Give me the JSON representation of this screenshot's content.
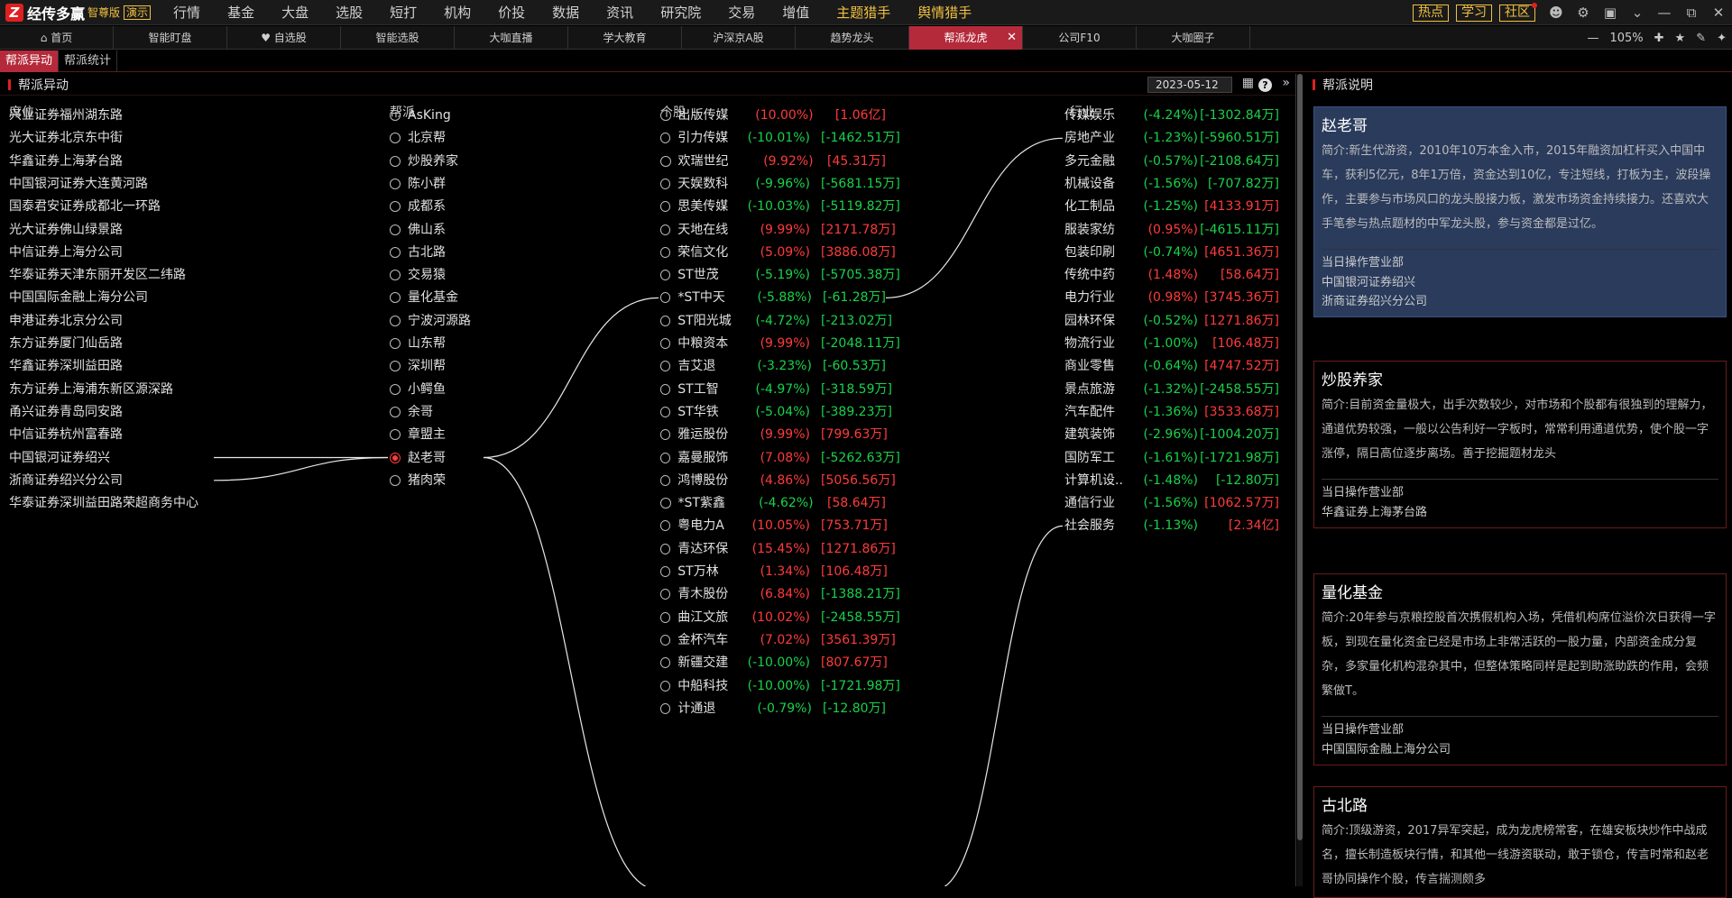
{
  "app": {
    "mark": "Z",
    "name": "经传多赢",
    "edition": "智尊版",
    "demo": "演示"
  },
  "menu": [
    {
      "label": "行情",
      "dot": true
    },
    {
      "label": "基金"
    },
    {
      "label": "大盘"
    },
    {
      "label": "选股"
    },
    {
      "label": "短打"
    },
    {
      "label": "机构"
    },
    {
      "label": "价投"
    },
    {
      "label": "数据"
    },
    {
      "label": "资讯"
    },
    {
      "label": "研究院"
    },
    {
      "label": "交易"
    },
    {
      "label": "增值",
      "dot": true
    },
    {
      "label": "主题猎手",
      "dot": true,
      "hl": true
    },
    {
      "label": "舆情猎手",
      "dot": true,
      "hl": true
    }
  ],
  "menu_right": {
    "pills": [
      {
        "label": "热点"
      },
      {
        "label": "学习"
      },
      {
        "label": "社区",
        "dot": true
      }
    ]
  },
  "tabs": [
    {
      "label": "首页",
      "icon": "home-icon"
    },
    {
      "label": "智能盯盘"
    },
    {
      "label": "自选股",
      "icon": "heart-icon"
    },
    {
      "label": "智能选股"
    },
    {
      "label": "大咖直播"
    },
    {
      "label": "学大教育"
    },
    {
      "label": "沪深京A股"
    },
    {
      "label": "趋势龙头"
    },
    {
      "label": "帮派龙虎",
      "active": true
    },
    {
      "label": "公司F10"
    },
    {
      "label": "大咖圈子"
    }
  ],
  "zoom": "105%",
  "subtabs": [
    {
      "label": "帮派异动",
      "active": true
    },
    {
      "label": "帮派统计"
    }
  ],
  "left_panel": {
    "title": "帮派异动",
    "date": "2023-05-12"
  },
  "columns": {
    "seat": "席位",
    "gang": "帮派",
    "stock": "个股",
    "industry": "行业"
  },
  "seats": [
    "兴业证券福州湖东路",
    "光大证券北京东中街",
    "华鑫证券上海茅台路",
    "中国银河证券大连黄河路",
    "国泰君安证券成都北一环路",
    "光大证券佛山绿景路",
    "中信证券上海分公司",
    "华泰证券天津东丽开发区二纬路",
    "中国国际金融上海分公司",
    "申港证券北京分公司",
    "东方证券厦门仙岳路",
    "华鑫证券深圳益田路",
    "东方证券上海浦东新区源深路",
    "甬兴证券青岛同安路",
    "中信证券杭州富春路",
    "中国银河证券绍兴",
    "浙商证券绍兴分公司",
    "华泰证券深圳益田路荣超商务中心"
  ],
  "gangs": [
    {
      "name": "AsKing"
    },
    {
      "name": "北京帮"
    },
    {
      "name": "炒股养家"
    },
    {
      "name": "陈小群"
    },
    {
      "name": "成都系"
    },
    {
      "name": "佛山系"
    },
    {
      "name": "古北路"
    },
    {
      "name": "交易猿"
    },
    {
      "name": "量化基金"
    },
    {
      "name": "宁波河源路"
    },
    {
      "name": "山东帮"
    },
    {
      "name": "深圳帮"
    },
    {
      "name": "小鳄鱼"
    },
    {
      "name": "余哥"
    },
    {
      "name": "章盟主"
    },
    {
      "name": "赵老哥",
      "selected": true
    },
    {
      "name": "猪肉荣"
    }
  ],
  "stocks": [
    {
      "name": "出版传媒",
      "pct": "(10.00%)",
      "amt": "[1.06亿]",
      "up": true,
      "amt_up": true
    },
    {
      "name": "引力传媒",
      "pct": "(-10.01%)",
      "amt": "[-1462.51万]",
      "up": false,
      "amt_up": false
    },
    {
      "name": "欢瑞世纪",
      "pct": "(9.92%)",
      "amt": "[45.31万]",
      "up": true,
      "amt_up": true
    },
    {
      "name": "天娱数科",
      "pct": "(-9.96%)",
      "amt": "[-5681.15万]",
      "up": false,
      "amt_up": false
    },
    {
      "name": "思美传媒",
      "pct": "(-10.03%)",
      "amt": "[-5119.82万]",
      "up": false,
      "amt_up": false
    },
    {
      "name": "天地在线",
      "pct": "(9.99%)",
      "amt": "[2171.78万]",
      "up": true,
      "amt_up": true
    },
    {
      "name": "荣信文化",
      "pct": "(5.09%)",
      "amt": "[3886.08万]",
      "up": true,
      "amt_up": true
    },
    {
      "name": "ST世茂",
      "pct": "(-5.19%)",
      "amt": "[-5705.38万]",
      "up": false,
      "amt_up": false
    },
    {
      "name": "*ST中天",
      "pct": "(-5.88%)",
      "amt": "[-61.28万]",
      "up": false,
      "amt_up": false
    },
    {
      "name": "ST阳光城",
      "pct": "(-4.72%)",
      "amt": "[-213.02万]",
      "up": false,
      "amt_up": false
    },
    {
      "name": "中粮资本",
      "pct": "(9.99%)",
      "amt": "[-2048.11万]",
      "up": true,
      "amt_up": false
    },
    {
      "name": "吉艾退",
      "pct": "(-3.23%)",
      "amt": "[-60.53万]",
      "up": false,
      "amt_up": false
    },
    {
      "name": "ST工智",
      "pct": "(-4.97%)",
      "amt": "[-318.59万]",
      "up": false,
      "amt_up": false
    },
    {
      "name": "ST华铁",
      "pct": "(-5.04%)",
      "amt": "[-389.23万]",
      "up": false,
      "amt_up": false
    },
    {
      "name": "雅运股份",
      "pct": "(9.99%)",
      "amt": "[799.63万]",
      "up": true,
      "amt_up": true
    },
    {
      "name": "嘉曼服饰",
      "pct": "(7.08%)",
      "amt": "[-5262.63万]",
      "up": true,
      "amt_up": false
    },
    {
      "name": "鸿博股份",
      "pct": "(4.86%)",
      "amt": "[5056.56万]",
      "up": true,
      "amt_up": true
    },
    {
      "name": "*ST紫鑫",
      "pct": "(-4.62%)",
      "amt": "[58.64万]",
      "up": false,
      "amt_up": true
    },
    {
      "name": "粤电力A",
      "pct": "(10.05%)",
      "amt": "[753.71万]",
      "up": true,
      "amt_up": true
    },
    {
      "name": "青达环保",
      "pct": "(15.45%)",
      "amt": "[1271.86万]",
      "up": true,
      "amt_up": true
    },
    {
      "name": "ST万林",
      "pct": "(1.34%)",
      "amt": "[106.48万]",
      "up": true,
      "amt_up": true
    },
    {
      "name": "青木股份",
      "pct": "(6.84%)",
      "amt": "[-1388.21万]",
      "up": true,
      "amt_up": false
    },
    {
      "name": "曲江文旅",
      "pct": "(10.02%)",
      "amt": "[-2458.55万]",
      "up": true,
      "amt_up": false
    },
    {
      "name": "金杯汽车",
      "pct": "(7.02%)",
      "amt": "[3561.39万]",
      "up": true,
      "amt_up": true
    },
    {
      "name": "新疆交建",
      "pct": "(-10.00%)",
      "amt": "[807.67万]",
      "up": false,
      "amt_up": true
    },
    {
      "name": "中船科技",
      "pct": "(-10.00%)",
      "amt": "[-1721.98万]",
      "up": false,
      "amt_up": false
    },
    {
      "name": "计通退",
      "pct": "(-0.79%)",
      "amt": "[-12.80万]",
      "up": false,
      "amt_up": false
    }
  ],
  "industries": [
    {
      "name": "传媒娱乐",
      "pct": "(-4.24%)",
      "amt": "[-1302.84万]",
      "up": false,
      "amt_up": false
    },
    {
      "name": "房地产业",
      "pct": "(-1.23%)",
      "amt": "[-5960.51万]",
      "up": false,
      "amt_up": false
    },
    {
      "name": "多元金融",
      "pct": "(-0.57%)",
      "amt": "[-2108.64万]",
      "up": false,
      "amt_up": false
    },
    {
      "name": "机械设备",
      "pct": "(-1.56%)",
      "amt": "[-707.82万]",
      "up": false,
      "amt_up": false
    },
    {
      "name": "化工制品",
      "pct": "(-1.25%)",
      "amt": "[4133.91万]",
      "up": false,
      "amt_up": true
    },
    {
      "name": "服装家纺",
      "pct": "(0.95%)",
      "amt": "[-4615.11万]",
      "up": true,
      "amt_up": false
    },
    {
      "name": "包装印刷",
      "pct": "(-0.74%)",
      "amt": "[4651.36万]",
      "up": false,
      "amt_up": true
    },
    {
      "name": "传统中药",
      "pct": "(1.48%)",
      "amt": "[58.64万]",
      "up": true,
      "amt_up": true
    },
    {
      "name": "电力行业",
      "pct": "(0.98%)",
      "amt": "[3745.36万]",
      "up": true,
      "amt_up": true
    },
    {
      "name": "园林环保",
      "pct": "(-0.52%)",
      "amt": "[1271.86万]",
      "up": false,
      "amt_up": true
    },
    {
      "name": "物流行业",
      "pct": "(-1.00%)",
      "amt": "[106.48万]",
      "up": false,
      "amt_up": true
    },
    {
      "name": "商业零售",
      "pct": "(-0.64%)",
      "amt": "[4747.52万]",
      "up": false,
      "amt_up": true
    },
    {
      "name": "景点旅游",
      "pct": "(-1.32%)",
      "amt": "[-2458.55万]",
      "up": false,
      "amt_up": false
    },
    {
      "name": "汽车配件",
      "pct": "(-1.36%)",
      "amt": "[3533.68万]",
      "up": false,
      "amt_up": true
    },
    {
      "name": "建筑装饰",
      "pct": "(-2.96%)",
      "amt": "[-1004.20万]",
      "up": false,
      "amt_up": false
    },
    {
      "name": "国防军工",
      "pct": "(-1.61%)",
      "amt": "[-1721.98万]",
      "up": false,
      "amt_up": false
    },
    {
      "name": "计算机设...",
      "pct": "(-1.48%)",
      "amt": "[-12.80万]",
      "up": false,
      "amt_up": false
    },
    {
      "name": "通信行业",
      "pct": "(-1.56%)",
      "amt": "[1062.57万]",
      "up": false,
      "amt_up": true
    },
    {
      "name": "社会服务",
      "pct": "(-1.13%)",
      "amt": "[2.34亿]",
      "up": false,
      "amt_up": true
    }
  ],
  "right_panel": {
    "title": "帮派说明",
    "cards": [
      {
        "name": "赵老哥",
        "selected": true,
        "desc": "简介:新生代游资，2010年10万本金入市，2015年融资加杠杆买入中国中车，获利5亿元，8年1万倍，资金达到10亿，专注短线，打板为主，波段操作，主要参与市场风口的龙头股接力板，激发市场资金持续接力。还喜欢大手笔参与热点题材的中军龙头股，参与资金都是过亿。",
        "label": "当日操作营业部",
        "branches": [
          "中国银河证券绍兴",
          "浙商证券绍兴分公司"
        ]
      },
      {
        "name": "炒股养家",
        "desc": "简介:目前资金量极大，出手次数较少，对市场和个股都有很独到的理解力，通道优势较强，一般以公告利好一字板时，常常利用通道优势，使个股一字涨停，隔日高位逐步离场。善于挖掘题材龙头",
        "label": "当日操作营业部",
        "branches": [
          "华鑫证券上海茅台路"
        ]
      },
      {
        "name": "量化基金",
        "desc": "简介:20年参与京粮控股首次携假机构入场，凭借机构席位溢价次日获得一字板，到现在量化资金已经是市场上非常活跃的一股力量，内部资金成分复杂，多家量化机构混杂其中，但整体策略同样是起到助涨助跌的作用，会频繁做T。",
        "label": "当日操作营业部",
        "branches": [
          "中国国际金融上海分公司"
        ]
      },
      {
        "name": "古北路",
        "desc": "简介:顶级游资，2017异军突起，成为龙虎榜常客，在雄安板块炒作中战成名，擅长制造板块行情，和其他一线游资联动，敢于锁仓，传言时常和赵老哥协同操作个股，传言揣测颇多",
        "label": "",
        "branches": []
      }
    ]
  }
}
